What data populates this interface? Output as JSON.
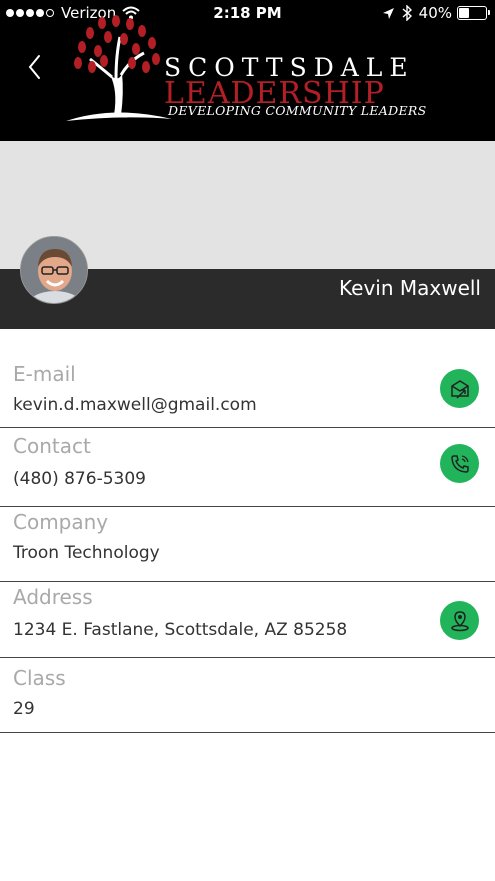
{
  "status_bar": {
    "carrier": "Verizon",
    "time": "2:18 PM",
    "battery": "40%",
    "battery_level": 0.4
  },
  "header": {
    "logo_line1": "SCOTTSDALE",
    "logo_line2": "LEADERSHIP",
    "logo_line3": "DEVELOPING COMMUNITY LEADERS",
    "brand_red": "#b31f24"
  },
  "profile": {
    "name": "Kevin Maxwell"
  },
  "details": {
    "email": {
      "label": "E-mail",
      "value": "kevin.d.maxwell@gmail.com",
      "icon": "send-mail-icon"
    },
    "contact": {
      "label": "Contact",
      "value": "(480) 876-5309",
      "icon": "phone-icon"
    },
    "company": {
      "label": "Company",
      "value": "Troon Technology"
    },
    "address": {
      "label": "Address",
      "value": "1234 E. Fastlane, Scottsdale, AZ 85258",
      "icon": "location-pin-icon"
    },
    "class": {
      "label": "Class",
      "value": "29"
    }
  },
  "colors": {
    "action_green": "#21b45a",
    "name_bar": "#2b2b2b",
    "cover": "#e3e3e3"
  }
}
